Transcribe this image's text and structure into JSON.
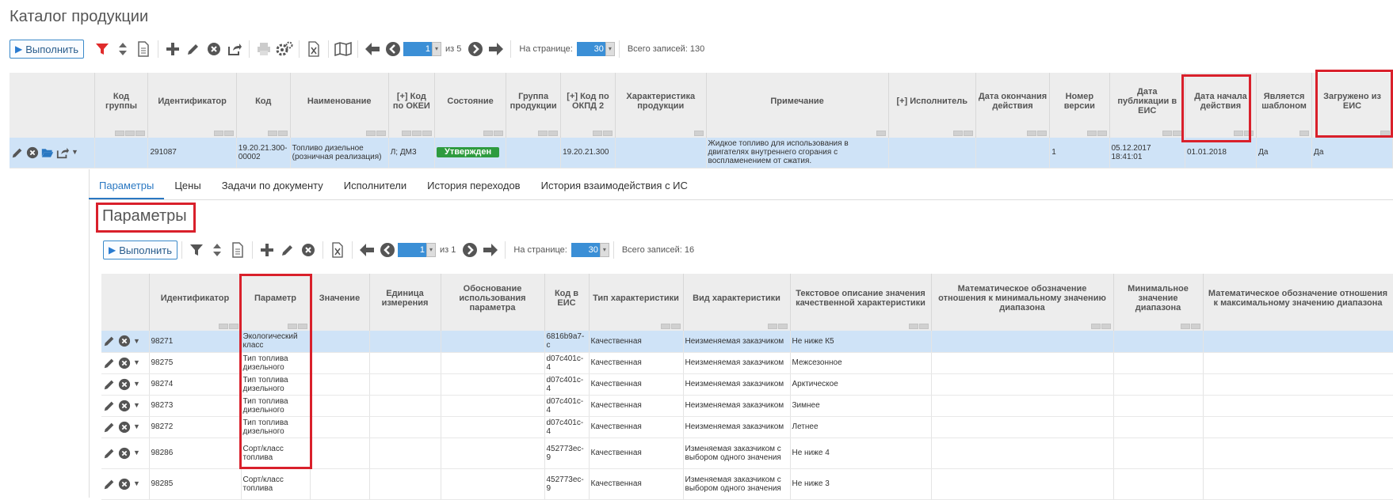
{
  "page": {
    "title": "Каталог продукции"
  },
  "toolbar": {
    "run_label": "Выполнить",
    "page_current": "1",
    "page_of": "из 5",
    "per_page_label": "На странице:",
    "per_page_value": "30",
    "total_label": "Всего записей: 130"
  },
  "main_grid": {
    "headers": {
      "group_code": "Код группы",
      "identifier": "Идентификатор",
      "code": "Код",
      "name": "Наименование",
      "okei": "[+] Код по ОКЕИ",
      "state": "Состояние",
      "product_group": "Группа продукции",
      "okpd2": "[+] Код по ОКПД 2",
      "characteristic": "Характеристика продукции",
      "note": "Примечание",
      "executor": "[+] Исполнитель",
      "end_date": "Дата окончания действия",
      "version": "Номер версии",
      "pub_date": "Дата публикации в ЕИС",
      "start_date": "Дата начала действия",
      "is_template": "Является шаблоном",
      "loaded_from_eis": "Загружено из ЕИС"
    },
    "row": {
      "group_code": "",
      "identifier": "291087",
      "code": "19.20.21.300-00002",
      "name": "Топливо дизельное (розничная реализация)",
      "okei": "Л; ДМ3",
      "state": "Утвержден",
      "product_group": "",
      "okpd2": "19.20.21.300",
      "characteristic": "",
      "note": "Жидкое топливо для использования в двигателях внутреннего сгорания с воспламенением от сжатия.",
      "executor": "",
      "end_date": "",
      "version": "1",
      "pub_date": "05.12.2017 18:41:01",
      "start_date": "01.01.2018",
      "is_template": "Да",
      "loaded_from_eis": "Да"
    }
  },
  "tabs": [
    "Параметры",
    "Цены",
    "Задачи по документу",
    "Исполнители",
    "История переходов",
    "История взаимодействия с ИС"
  ],
  "params": {
    "title": "Параметры",
    "toolbar": {
      "run_label": "Выполнить",
      "page_current": "1",
      "page_of": "из 1",
      "per_page_label": "На странице:",
      "per_page_value": "30",
      "total_label": "Всего записей: 16"
    },
    "headers": {
      "identifier": "Идентификатор",
      "parameter": "Параметр",
      "value": "Значение",
      "unit": "Единица измерения",
      "basis": "Обоснование использования параметра",
      "eis_code": "Код в ЕИС",
      "char_type": "Тип характеристики",
      "char_kind": "Вид характеристики",
      "text_desc": "Текстовое описание значения качественной характеристики",
      "math_min": "Математическое обозначение отношения к минимальному значению диапазона",
      "min_value": "Минимальное значение диапазона",
      "math_max": "Математическое обозначение отношения к максимальному значению диапазона"
    },
    "rows": [
      {
        "id": "98271",
        "param": "Экологический класс",
        "eis": "6816b9a7-c",
        "type": "Качественная",
        "kind": "Неизменяемая заказчиком",
        "text": "Не ниже К5"
      },
      {
        "id": "98275",
        "param": "Тип топлива дизельного",
        "eis": "d07c401c-4",
        "type": "Качественная",
        "kind": "Неизменяемая заказчиком",
        "text": "Межсезонное"
      },
      {
        "id": "98274",
        "param": "Тип топлива дизельного",
        "eis": "d07c401c-4",
        "type": "Качественная",
        "kind": "Неизменяемая заказчиком",
        "text": "Арктическое"
      },
      {
        "id": "98273",
        "param": "Тип топлива дизельного",
        "eis": "d07c401c-4",
        "type": "Качественная",
        "kind": "Неизменяемая заказчиком",
        "text": "Зимнее"
      },
      {
        "id": "98272",
        "param": "Тип топлива дизельного",
        "eis": "d07c401c-4",
        "type": "Качественная",
        "kind": "Неизменяемая заказчиком",
        "text": "Летнее"
      },
      {
        "id": "98286",
        "param": "Сорт/класс топлива",
        "eis": "452773ec-9",
        "type": "Качественная",
        "kind": "Изменяемая заказчиком с выбором одного значения",
        "text": "Не ниже 4"
      },
      {
        "id": "98285",
        "param": "Сорт/класс топлива",
        "eis": "452773ec-9",
        "type": "Качественная",
        "kind": "Изменяемая заказчиком с выбором одного значения",
        "text": "Не ниже 3"
      }
    ]
  },
  "colors": {
    "accent": "#2a78c2",
    "status_green": "#2e9b3e",
    "highlight": "#d9202b",
    "selected_row": "#cfe3f7"
  }
}
